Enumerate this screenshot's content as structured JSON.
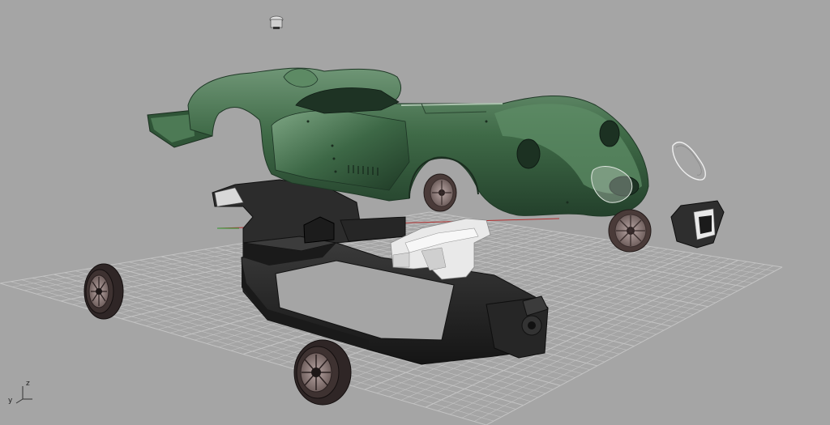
{
  "viewport": {
    "background": "#a5a5a5",
    "grid_color": "#c4c4c4",
    "grid_axis_x_color": "#b03030",
    "grid_axis_y_color": "#2f9a2f",
    "body_color": "#3e6a45",
    "chassis_color": "#2a2a2a",
    "wheel_tire_color": "#3a3030",
    "wheel_rim_color": "#8c7a78",
    "parts_white_color": "#e8e8e8"
  },
  "axis_indicator": {
    "z_label": "z",
    "y_label": "y"
  },
  "parts": [
    "body-shell",
    "underbody-tray",
    "chassis-frame",
    "front-bumper-bracket",
    "wheel-front-left",
    "wheel-front-right",
    "wheel-rear-left",
    "wheel-rear-right",
    "headlight-lens",
    "tail-lamp-housing",
    "fuel-cap"
  ]
}
